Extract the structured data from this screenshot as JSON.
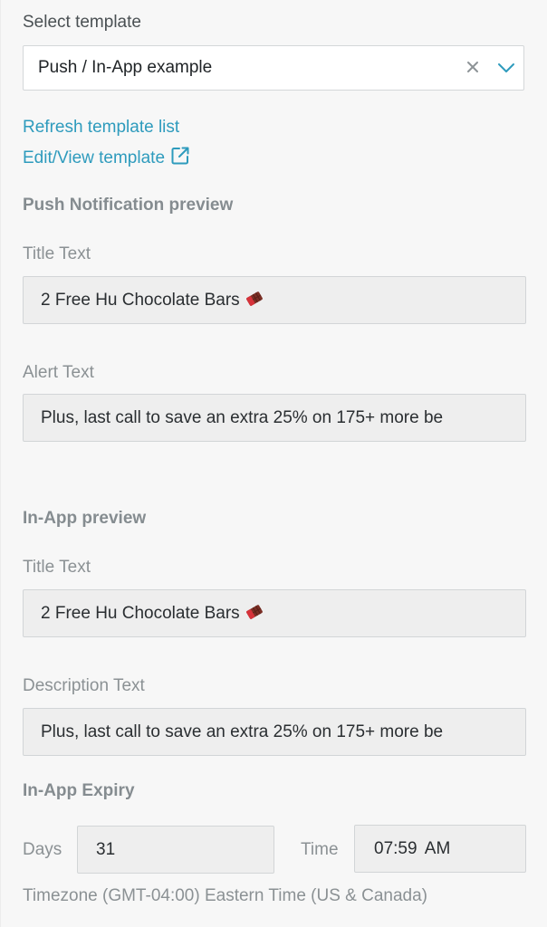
{
  "template_select": {
    "label": "Select template",
    "value": "Push / In-App example"
  },
  "links": {
    "refresh": "Refresh template list",
    "edit_view": "Edit/View template"
  },
  "push_preview": {
    "heading": "Push Notification preview",
    "title_label": "Title Text",
    "title_value": "2 Free Hu Chocolate Bars",
    "alert_label": "Alert Text",
    "alert_value": "Plus, last call to save an extra 25% on 175+ more be"
  },
  "inapp_preview": {
    "heading": "In-App preview",
    "title_label": "Title Text",
    "title_value": "2 Free Hu Chocolate Bars",
    "description_label": "Description Text",
    "description_value": "Plus, last call to save an extra 25% on 175+ more be"
  },
  "expiry": {
    "heading": "In-App Expiry",
    "days_label": "Days",
    "days_value": "31",
    "time_label": "Time",
    "time_value": "07:59 AM",
    "timezone": "Timezone (GMT-04:00) Eastern Time (US & Canada)"
  },
  "colors": {
    "link": "#2e9bbd",
    "background": "#f7f7f7",
    "field_fill": "#eeeeee"
  },
  "icons": [
    "clear-icon",
    "chevron-down-icon",
    "external-link-icon",
    "chocolate-bar-icon"
  ]
}
